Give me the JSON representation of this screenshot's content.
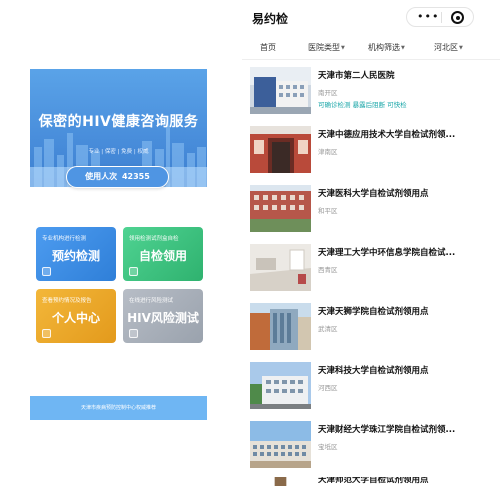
{
  "left_panel": {
    "banner": {
      "title": "保密的HIV健康咨询服务",
      "tags": "专业 | 保密 | 免费 | 权威"
    },
    "usage": {
      "label": "使用人次",
      "count": "42355"
    },
    "cards": [
      {
        "sub": "专业机构进行检测",
        "main": "预约检测",
        "color": "#3a8ce6"
      },
      {
        "sub": "领用检测试剂盒自检",
        "main": "自检领用",
        "color": "#3fc482"
      },
      {
        "sub": "查看预约情况及报告",
        "main": "个人中心",
        "color": "#eeaa2c"
      },
      {
        "sub": "在线进行风险测试",
        "main": "HIV风险测试",
        "color": "#a9b0ba"
      }
    ],
    "footer": "天津市疾病预防控制中心权威推荐"
  },
  "right_panel": {
    "app_title": "易约检",
    "filters": [
      {
        "label": "首页",
        "has_caret": false
      },
      {
        "label": "医院类型",
        "has_caret": true
      },
      {
        "label": "机构筛选",
        "has_caret": true
      },
      {
        "label": "河北区",
        "has_caret": true
      }
    ],
    "list": [
      {
        "name": "天津市第二人民医院",
        "district": "南开区",
        "tags": "可确诊检测 暴露后阻断 可快检",
        "thumb": "hospital"
      },
      {
        "name": "天津中德应用技术大学自检试剂领...",
        "district": "津南区",
        "tags": "",
        "thumb": "red-door"
      },
      {
        "name": "天津医科大学自检试剂领用点",
        "district": "和平区",
        "tags": "",
        "thumb": "red-building"
      },
      {
        "name": "天津理工大学中环信息学院自检试...",
        "district": "西青区",
        "tags": "",
        "thumb": "room"
      },
      {
        "name": "天津天狮学院自检试剂领用点",
        "district": "武清区",
        "tags": "",
        "thumb": "campus"
      },
      {
        "name": "天津科技大学自检试剂领用点",
        "district": "河西区",
        "tags": "",
        "thumb": "white-building"
      },
      {
        "name": "天津财经大学珠江学院自检试剂领...",
        "district": "宝坻区",
        "tags": "",
        "thumb": "long-building"
      },
      {
        "name": "天津师范大学自检试剂领用点",
        "district": "",
        "tags": "",
        "thumb": "partial"
      }
    ]
  },
  "icons": {
    "more": "more-dots-icon",
    "close": "target-circle-icon",
    "card": "card-doc-icon"
  }
}
